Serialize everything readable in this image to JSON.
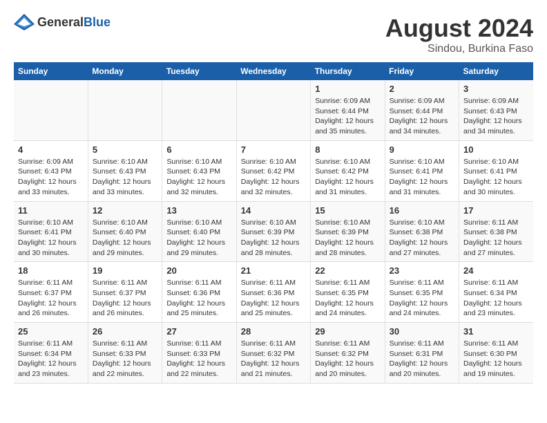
{
  "header": {
    "logo_general": "General",
    "logo_blue": "Blue",
    "title": "August 2024",
    "subtitle": "Sindou, Burkina Faso"
  },
  "days_of_week": [
    "Sunday",
    "Monday",
    "Tuesday",
    "Wednesday",
    "Thursday",
    "Friday",
    "Saturday"
  ],
  "weeks": [
    [
      {
        "day": "",
        "info": ""
      },
      {
        "day": "",
        "info": ""
      },
      {
        "day": "",
        "info": ""
      },
      {
        "day": "",
        "info": ""
      },
      {
        "day": "1",
        "info": "Sunrise: 6:09 AM\nSunset: 6:44 PM\nDaylight: 12 hours and 35 minutes."
      },
      {
        "day": "2",
        "info": "Sunrise: 6:09 AM\nSunset: 6:44 PM\nDaylight: 12 hours and 34 minutes."
      },
      {
        "day": "3",
        "info": "Sunrise: 6:09 AM\nSunset: 6:43 PM\nDaylight: 12 hours and 34 minutes."
      }
    ],
    [
      {
        "day": "4",
        "info": "Sunrise: 6:09 AM\nSunset: 6:43 PM\nDaylight: 12 hours and 33 minutes."
      },
      {
        "day": "5",
        "info": "Sunrise: 6:10 AM\nSunset: 6:43 PM\nDaylight: 12 hours and 33 minutes."
      },
      {
        "day": "6",
        "info": "Sunrise: 6:10 AM\nSunset: 6:43 PM\nDaylight: 12 hours and 32 minutes."
      },
      {
        "day": "7",
        "info": "Sunrise: 6:10 AM\nSunset: 6:42 PM\nDaylight: 12 hours and 32 minutes."
      },
      {
        "day": "8",
        "info": "Sunrise: 6:10 AM\nSunset: 6:42 PM\nDaylight: 12 hours and 31 minutes."
      },
      {
        "day": "9",
        "info": "Sunrise: 6:10 AM\nSunset: 6:41 PM\nDaylight: 12 hours and 31 minutes."
      },
      {
        "day": "10",
        "info": "Sunrise: 6:10 AM\nSunset: 6:41 PM\nDaylight: 12 hours and 30 minutes."
      }
    ],
    [
      {
        "day": "11",
        "info": "Sunrise: 6:10 AM\nSunset: 6:41 PM\nDaylight: 12 hours and 30 minutes."
      },
      {
        "day": "12",
        "info": "Sunrise: 6:10 AM\nSunset: 6:40 PM\nDaylight: 12 hours and 29 minutes."
      },
      {
        "day": "13",
        "info": "Sunrise: 6:10 AM\nSunset: 6:40 PM\nDaylight: 12 hours and 29 minutes."
      },
      {
        "day": "14",
        "info": "Sunrise: 6:10 AM\nSunset: 6:39 PM\nDaylight: 12 hours and 28 minutes."
      },
      {
        "day": "15",
        "info": "Sunrise: 6:10 AM\nSunset: 6:39 PM\nDaylight: 12 hours and 28 minutes."
      },
      {
        "day": "16",
        "info": "Sunrise: 6:10 AM\nSunset: 6:38 PM\nDaylight: 12 hours and 27 minutes."
      },
      {
        "day": "17",
        "info": "Sunrise: 6:11 AM\nSunset: 6:38 PM\nDaylight: 12 hours and 27 minutes."
      }
    ],
    [
      {
        "day": "18",
        "info": "Sunrise: 6:11 AM\nSunset: 6:37 PM\nDaylight: 12 hours and 26 minutes."
      },
      {
        "day": "19",
        "info": "Sunrise: 6:11 AM\nSunset: 6:37 PM\nDaylight: 12 hours and 26 minutes."
      },
      {
        "day": "20",
        "info": "Sunrise: 6:11 AM\nSunset: 6:36 PM\nDaylight: 12 hours and 25 minutes."
      },
      {
        "day": "21",
        "info": "Sunrise: 6:11 AM\nSunset: 6:36 PM\nDaylight: 12 hours and 25 minutes."
      },
      {
        "day": "22",
        "info": "Sunrise: 6:11 AM\nSunset: 6:35 PM\nDaylight: 12 hours and 24 minutes."
      },
      {
        "day": "23",
        "info": "Sunrise: 6:11 AM\nSunset: 6:35 PM\nDaylight: 12 hours and 24 minutes."
      },
      {
        "day": "24",
        "info": "Sunrise: 6:11 AM\nSunset: 6:34 PM\nDaylight: 12 hours and 23 minutes."
      }
    ],
    [
      {
        "day": "25",
        "info": "Sunrise: 6:11 AM\nSunset: 6:34 PM\nDaylight: 12 hours and 23 minutes."
      },
      {
        "day": "26",
        "info": "Sunrise: 6:11 AM\nSunset: 6:33 PM\nDaylight: 12 hours and 22 minutes."
      },
      {
        "day": "27",
        "info": "Sunrise: 6:11 AM\nSunset: 6:33 PM\nDaylight: 12 hours and 22 minutes."
      },
      {
        "day": "28",
        "info": "Sunrise: 6:11 AM\nSunset: 6:32 PM\nDaylight: 12 hours and 21 minutes."
      },
      {
        "day": "29",
        "info": "Sunrise: 6:11 AM\nSunset: 6:32 PM\nDaylight: 12 hours and 20 minutes."
      },
      {
        "day": "30",
        "info": "Sunrise: 6:11 AM\nSunset: 6:31 PM\nDaylight: 12 hours and 20 minutes."
      },
      {
        "day": "31",
        "info": "Sunrise: 6:11 AM\nSunset: 6:30 PM\nDaylight: 12 hours and 19 minutes."
      }
    ]
  ]
}
